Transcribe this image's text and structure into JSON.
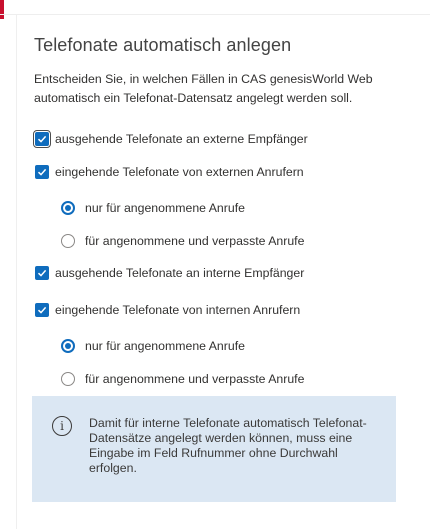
{
  "section": {
    "title": "Telefonate automatisch anlegen",
    "description": "Entscheiden Sie, in welchen Fällen in CAS genesisWorld Web automatisch ein Telefonat-Datensatz angelegt werden soll."
  },
  "options": {
    "outgoing_external": {
      "label": "ausgehende Telefonate an externe Empfänger",
      "checked": true
    },
    "incoming_external": {
      "label": "eingehende Telefonate von externen Anrufern",
      "checked": true,
      "radio_answered": "nur für angenommene Anrufe",
      "radio_answered_missed": "für angenommene und verpasste Anrufe",
      "selected": "answered"
    },
    "outgoing_internal": {
      "label": "ausgehende Telefonate an interne Empfänger",
      "checked": true
    },
    "incoming_internal": {
      "label": "eingehende Telefonate von internen Anrufern",
      "checked": true,
      "radio_answered": "nur für angenommene Anrufe",
      "radio_answered_missed": "für angenommene und verpasste Anrufe",
      "selected": "answered"
    }
  },
  "info_box": {
    "icon": "info-icon",
    "glyph": "i",
    "text": "Damit für interne Telefonate automatisch Telefonat-Datensätze angelegt werden können, muss eine Eingabe im Feld Rufnummer ohne Durchwahl erfolgen."
  },
  "colors": {
    "accent": "#0f6cbd",
    "brand_red": "#c8102e",
    "info_background": "#dbe7f3"
  }
}
